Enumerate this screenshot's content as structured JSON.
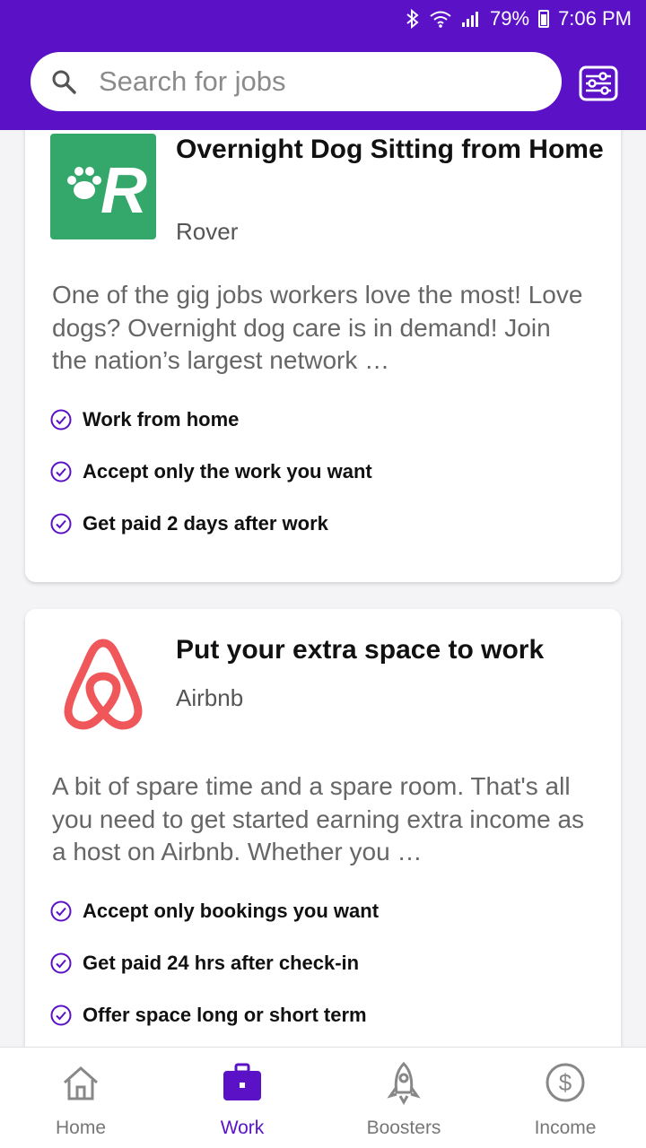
{
  "status_bar": {
    "left_text": "",
    "battery": "79%",
    "time": "7:06 PM"
  },
  "search": {
    "placeholder": "Search for jobs"
  },
  "cards": [
    {
      "title": "Overnight Dog Sitting from Home",
      "company": "Rover",
      "description": "One of the gig jobs workers love the most! Love dogs? Overnight dog care is in demand! Join the nation’s largest network …",
      "features": [
        "Work from home",
        "Accept only the work you want",
        "Get paid 2 days after work"
      ]
    },
    {
      "title": "Put your extra space to work",
      "company": "Airbnb",
      "description": "A bit of spare time and a spare room. That's all you need to get started earning extra income as a host on Airbnb. Whether you …",
      "features": [
        "Accept only bookings you want",
        "Get paid 24 hrs after check-in",
        "Offer space long or short term"
      ]
    }
  ],
  "bottom_nav": {
    "items": [
      {
        "label": "Home",
        "icon": "home-icon"
      },
      {
        "label": "Work",
        "icon": "briefcase-icon"
      },
      {
        "label": "Boosters",
        "icon": "rocket-icon"
      },
      {
        "label": "Income",
        "icon": "dollar-icon"
      }
    ],
    "active": "Work"
  },
  "colors": {
    "brand": "#5b12c7",
    "rover_green": "#34a76b",
    "airbnb_red": "#f0575a"
  }
}
